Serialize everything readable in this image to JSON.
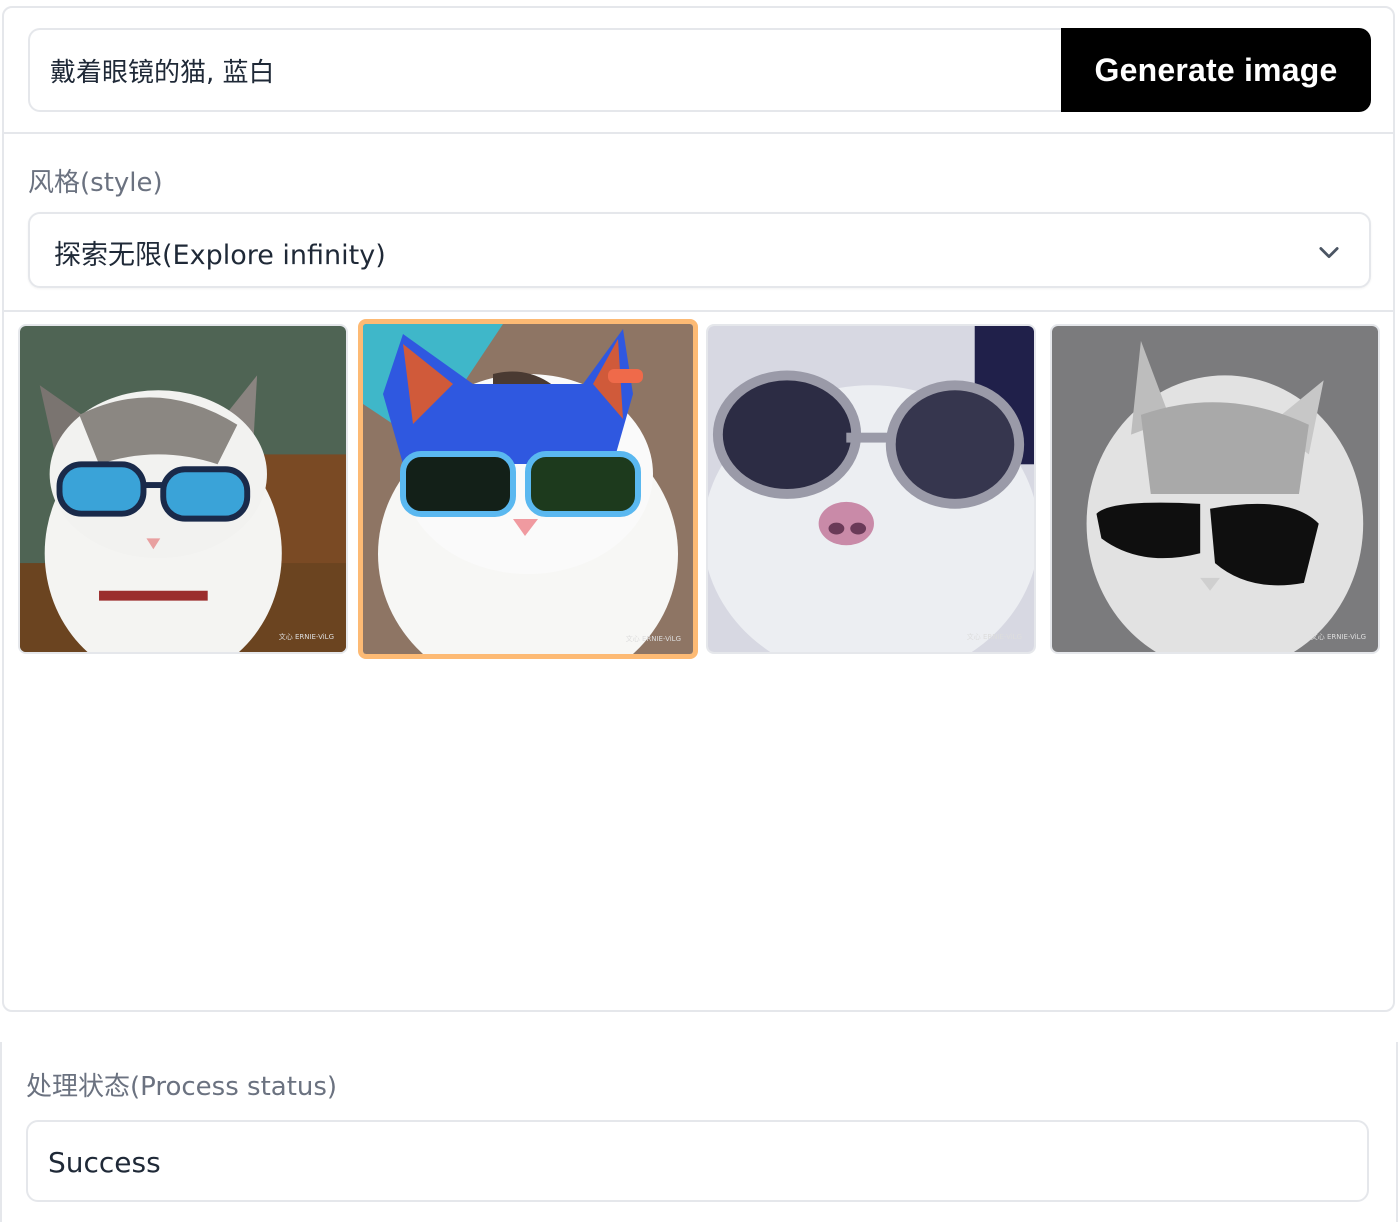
{
  "prompt": {
    "value": "戴着眼镜的猫, 蓝白",
    "button_label": "Generate image"
  },
  "style": {
    "label": "风格(style)",
    "selected": "探索无限(Explore infinity)",
    "chevron_icon": "chevron-down-icon"
  },
  "gallery": {
    "selected_index": 1,
    "items": [
      {
        "alt": "cat with blue glasses",
        "watermark": "文心 ERNIE-ViLG"
      },
      {
        "alt": "cat with blue mask and sunglasses",
        "watermark": "文心 ERNIE-ViLG"
      },
      {
        "alt": "cat with round glasses",
        "watermark": "文心 ERNIE-ViLG"
      },
      {
        "alt": "grayscale cat with black sunglasses",
        "watermark": "文心 ERNIE-ViLG"
      }
    ]
  },
  "status": {
    "label": "处理状态(Process status)",
    "value": "Success"
  },
  "colors": {
    "button_bg": "#000000",
    "selected_border": "#fdba74",
    "border": "#e5e7eb",
    "label_text": "#6b7280"
  }
}
